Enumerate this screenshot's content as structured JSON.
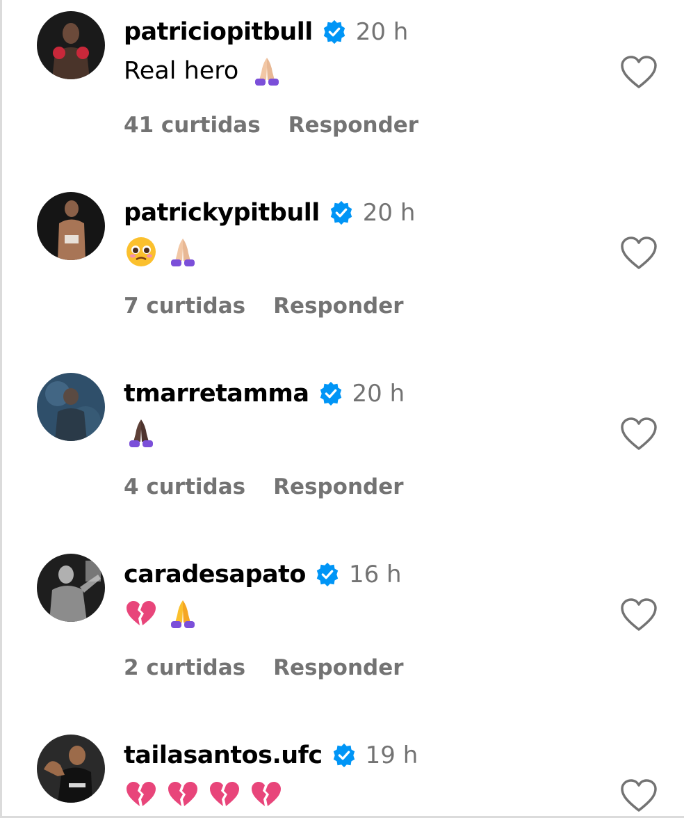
{
  "comments": [
    {
      "username": "patriciopitbull",
      "time": "20 h",
      "text": "Real hero",
      "emojis": [
        "folded-hands-light"
      ],
      "likes": "41 curtidas",
      "reply": "Responder"
    },
    {
      "username": "patrickypitbull",
      "time": "20 h",
      "text": "",
      "emojis": [
        "pleading-face",
        "folded-hands-light"
      ],
      "likes": "7 curtidas",
      "reply": "Responder"
    },
    {
      "username": "tmarretamma",
      "time": "20 h",
      "text": "",
      "emojis": [
        "folded-hands-dark"
      ],
      "likes": "4 curtidas",
      "reply": "Responder"
    },
    {
      "username": "caradesapato",
      "time": "16 h",
      "text": "",
      "emojis": [
        "broken-heart",
        "folded-hands-yellow"
      ],
      "likes": "2 curtidas",
      "reply": "Responder"
    },
    {
      "username": "tailasantos.ufc",
      "time": "19 h",
      "text": "",
      "emojis": [
        "broken-heart",
        "broken-heart",
        "broken-heart",
        "broken-heart"
      ],
      "likes": "",
      "reply": ""
    }
  ],
  "colors": {
    "verified": "#0095f6",
    "secondary_text": "#737373",
    "heart_outline": "#737373",
    "broken_heart": "#e8457a",
    "sleeve": "#7b4fd9"
  }
}
